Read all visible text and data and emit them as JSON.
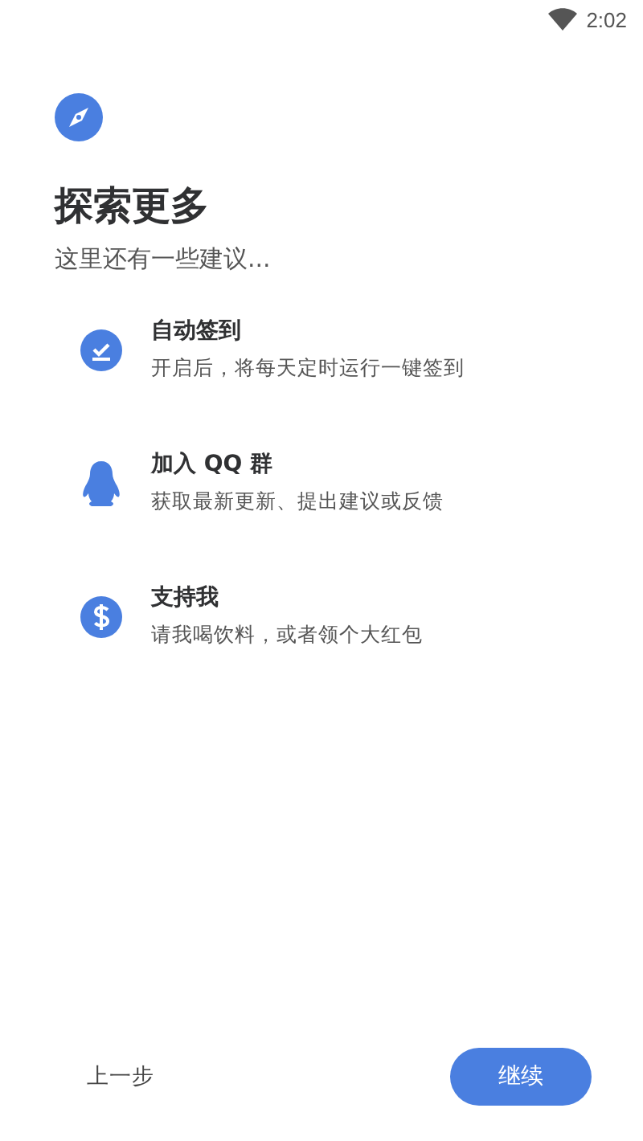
{
  "status_bar": {
    "time": "2:02"
  },
  "header": {
    "title": "探索更多",
    "subtitle": "这里还有一些建议..."
  },
  "items": [
    {
      "kind": "checkin",
      "title": "自动签到",
      "description": "开启后，将每天定时运行一键签到"
    },
    {
      "kind": "qq",
      "title": "加入 QQ 群",
      "description": "获取最新更新、提出建议或反馈"
    },
    {
      "kind": "donate",
      "title": "支持我",
      "description": "请我喝饮料，或者领个大红包"
    }
  ],
  "footer": {
    "back": "上一步",
    "next": "继续"
  }
}
